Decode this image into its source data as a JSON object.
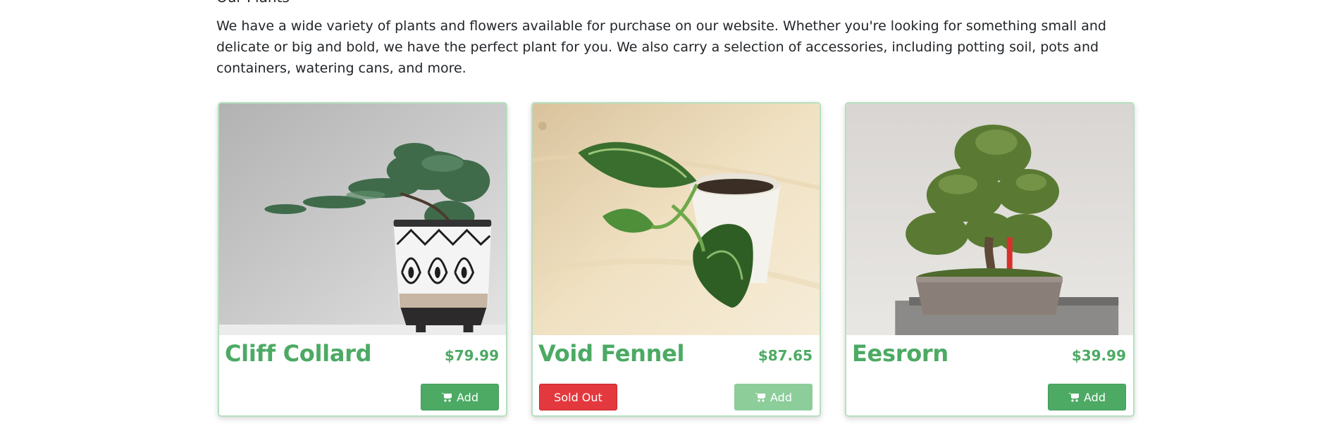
{
  "page": {
    "heading_fragment": "Our Plants",
    "intro_text": "We have a wide variety of plants and flowers available for purchase on our website. Whether you're looking for something small and delicate or big and bold, we have the perfect plant for you. We also carry a selection of accessories, including potting soil, pots and containers, watering cans, and more."
  },
  "colors": {
    "brand_green": "#4caa64",
    "sold_out_red": "#e3393e",
    "card_border": "#b5e0c0"
  },
  "products": [
    {
      "name": "Cliff Collard",
      "price": "$79.99",
      "add_label": "Add",
      "add_icon": "cart-icon",
      "sold_out": false,
      "image": "juniper-bonsai-in-patterned-pot"
    },
    {
      "name": "Void Fennel",
      "price": "$87.65",
      "add_label": "Add",
      "add_icon": "cart-icon",
      "sold_out": true,
      "sold_out_label": "Sold Out",
      "image": "pothos-cutting-in-white-pot"
    },
    {
      "name": "Eesrorn",
      "price": "$39.99",
      "add_label": "Add",
      "add_icon": "cart-icon",
      "sold_out": false,
      "image": "bonsai-tree-in-clay-pot"
    }
  ]
}
